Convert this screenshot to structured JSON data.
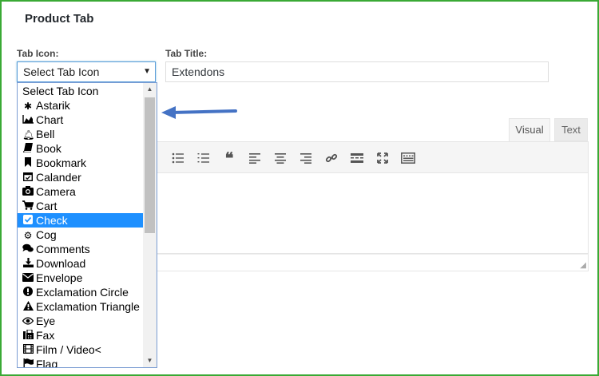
{
  "panel": {
    "title": "Product Tab"
  },
  "fields": {
    "tab_icon_label": "Tab Icon:",
    "tab_title_label": "Tab Title:",
    "tab_icon_selected": "Select Tab Icon",
    "tab_title_value": "Extendons"
  },
  "editor": {
    "tab_visual": "Visual",
    "tab_text": "Text",
    "toolbar_icons": [
      "bullet-list-icon",
      "numbered-list-icon",
      "blockquote-icon",
      "align-left-icon",
      "align-center-icon",
      "align-right-icon",
      "link-icon",
      "read-more-icon",
      "fullscreen-icon",
      "toolbar-toggle-icon"
    ]
  },
  "dropdown": {
    "options": [
      {
        "label": "Select Tab Icon",
        "icon": ""
      },
      {
        "label": "Astarik",
        "icon": "asterisk-icon"
      },
      {
        "label": "Chart",
        "icon": "area-chart-icon"
      },
      {
        "label": "Bell",
        "icon": "bell-icon"
      },
      {
        "label": "Book",
        "icon": "book-icon"
      },
      {
        "label": "Bookmark",
        "icon": "bookmark-icon"
      },
      {
        "label": "Calander",
        "icon": "calendar-check-icon"
      },
      {
        "label": "Camera",
        "icon": "camera-icon"
      },
      {
        "label": "Cart",
        "icon": "cart-icon"
      },
      {
        "label": "Check",
        "icon": "check-square-icon",
        "selected": true
      },
      {
        "label": "Cog",
        "icon": "cog-icon"
      },
      {
        "label": "Comments",
        "icon": "comments-icon"
      },
      {
        "label": "Download",
        "icon": "download-icon"
      },
      {
        "label": "Envelope",
        "icon": "envelope-icon"
      },
      {
        "label": "Exclamation Circle",
        "icon": "exclamation-circle-icon"
      },
      {
        "label": "Exclamation Triangle",
        "icon": "exclamation-triangle-icon"
      },
      {
        "label": "Eye",
        "icon": "eye-icon"
      },
      {
        "label": "Fax",
        "icon": "fax-icon"
      },
      {
        "label": "Film / Video<",
        "icon": "film-icon"
      },
      {
        "label": "Flag",
        "icon": "flag-icon"
      }
    ]
  },
  "colors": {
    "frame_border": "#3aa935",
    "selected_bg": "#1e90ff",
    "arrow": "#4472c4"
  }
}
